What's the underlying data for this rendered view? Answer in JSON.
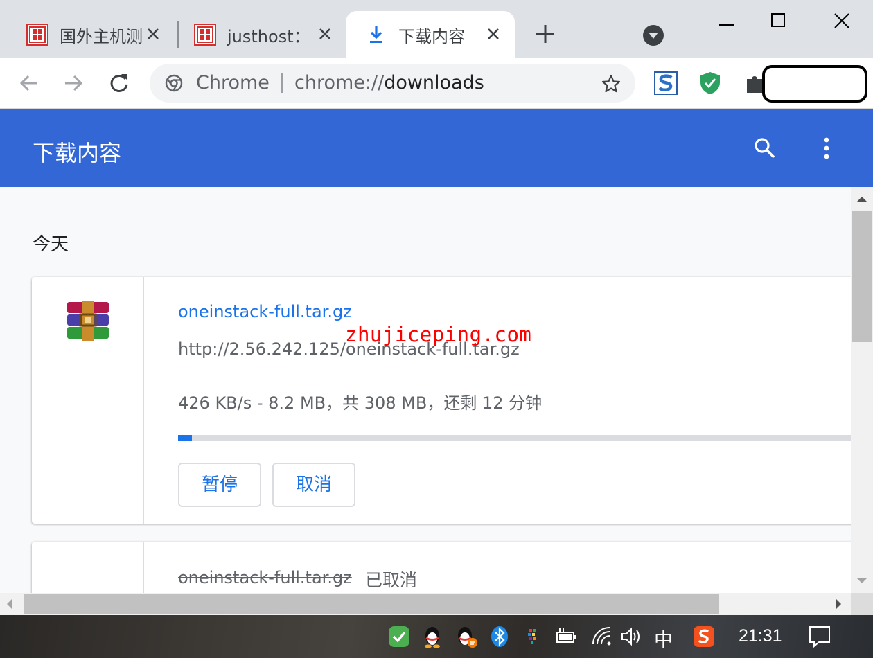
{
  "tabs": [
    {
      "title": "国外主机测",
      "close_icon": "close-icon",
      "active": false
    },
    {
      "title": "justhost：",
      "close_icon": "close-icon",
      "active": false
    },
    {
      "title": "下载内容",
      "close_icon": "close-icon",
      "active": true
    }
  ],
  "window_controls": [
    "minimize-icon",
    "maximize-icon",
    "close-icon"
  ],
  "omnibox": {
    "scheme_label": "Chrome",
    "url_prefix": "chrome://",
    "url_host": "downloads"
  },
  "downloads_page": {
    "header_title": "下载内容",
    "section_label": "今天",
    "accent_color": "#3367d6",
    "link_color": "#1a73e8",
    "items": [
      {
        "file_name": "oneinstack-full.tar.gz",
        "url": "http://2.56.242.125/oneinstack-full.tar.gz",
        "status": "426 KB/s - 8.2 MB，共 308 MB，还剩 12 分钟",
        "progress_percent": 2,
        "pause_label": "暂停",
        "cancel_label": "取消"
      },
      {
        "file_name": "oneinstack-full.tar.gz",
        "status_badge": "已取消"
      }
    ]
  },
  "watermark": "zhujiceping.com",
  "taskbar": {
    "ime_label": "中",
    "clock": "21:31"
  }
}
